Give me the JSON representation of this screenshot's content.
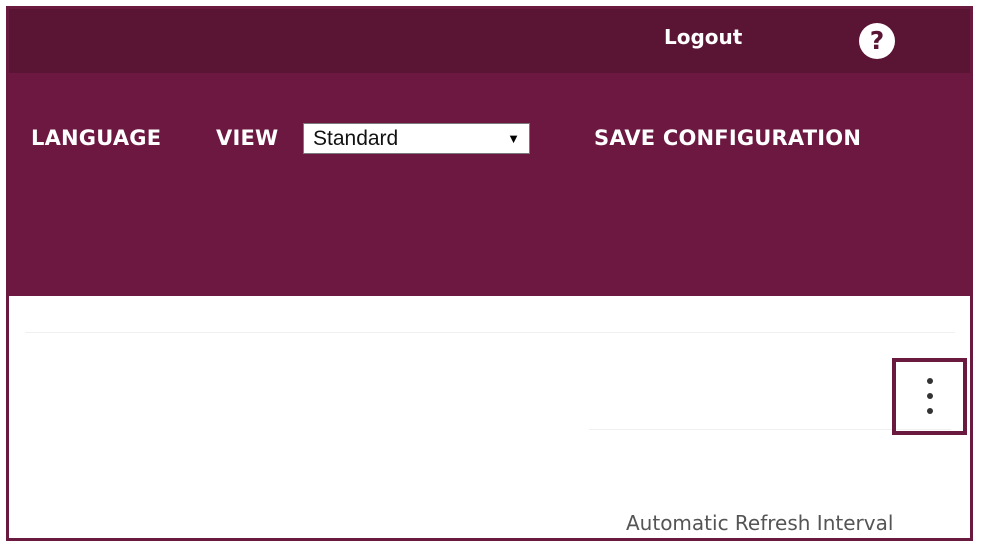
{
  "header": {
    "logout_label": "Logout",
    "help_label": "?"
  },
  "menu": {
    "language_label": "LANGUAGE",
    "view_label": "VIEW",
    "view_selected": "Standard",
    "save_label": "SAVE CONFIGURATION"
  },
  "content": {
    "automatic_refresh_label": "Automatic Refresh Interval"
  },
  "colors": {
    "topbar": "#5a1534",
    "menubar": "#6c1841",
    "border": "#6b1a3f"
  },
  "icons": {
    "help": "question-mark-icon",
    "more": "more-vertical-icon",
    "select": "chevron-down-icon"
  }
}
